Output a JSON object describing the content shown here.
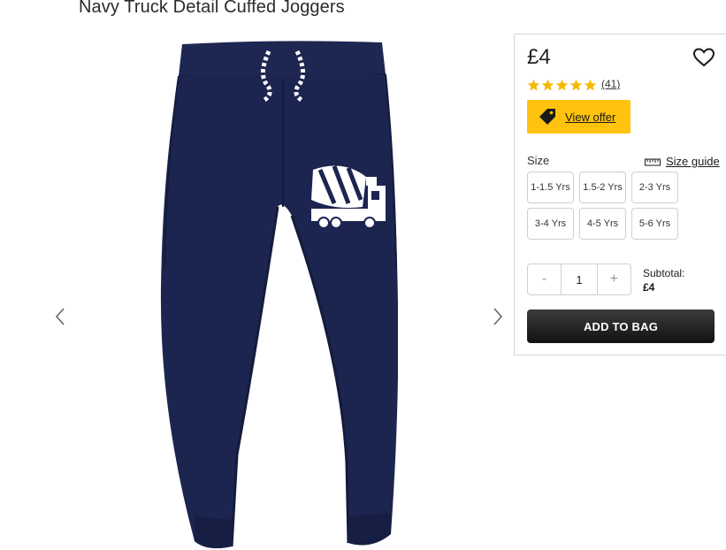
{
  "product": {
    "title": "Navy Truck Detail Cuffed Joggers",
    "image_alt": "Navy jogging bottoms with a white cement mixer truck print"
  },
  "gallery": {
    "prev_icon": "chevron-left-icon",
    "next_icon": "chevron-right-icon"
  },
  "panel": {
    "price": "£4",
    "rating": 5,
    "review_count": "(41)",
    "offer_label": "View offer",
    "size_label": "Size",
    "size_guide_label": "Size guide",
    "sizes": [
      "1-1.5 Yrs",
      "1.5-2 Yrs",
      "2-3 Yrs",
      "3-4 Yrs",
      "4-5 Yrs",
      "5-6 Yrs"
    ],
    "qty_minus": "-",
    "qty_value": "1",
    "qty_plus": "+",
    "subtotal_label": "Subtotal:",
    "subtotal_value": "£4",
    "add_to_bag": "ADD TO BAG"
  },
  "colors": {
    "offer": "#ffc20e",
    "star": "#f5b800",
    "navy": "#1c2550",
    "button": "#1a1a1a"
  }
}
